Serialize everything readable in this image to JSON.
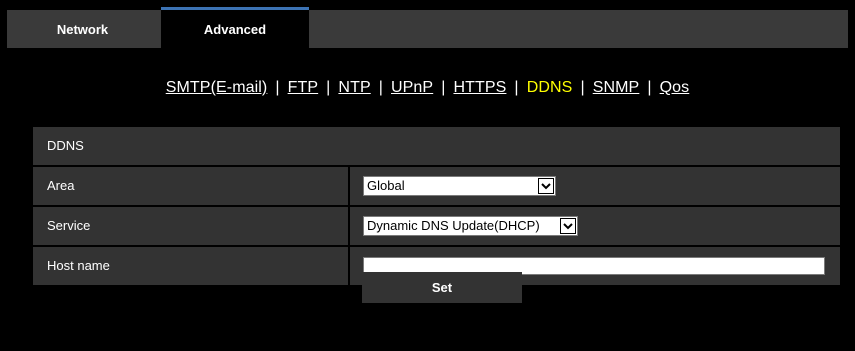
{
  "tabs": {
    "network": "Network",
    "advanced": "Advanced"
  },
  "links": {
    "smtp": "SMTP(E-mail)",
    "ftp": "FTP",
    "ntp": "NTP",
    "upnp": "UPnP",
    "https": "HTTPS",
    "ddns": "DDNS",
    "snmp": "SNMP",
    "qos": "Qos",
    "separator": "|"
  },
  "section": {
    "title": "DDNS"
  },
  "fields": {
    "area_label": "Area",
    "area_value": "Global",
    "service_label": "Service",
    "service_value": "Dynamic DNS Update(DHCP)",
    "hostname_label": "Host name",
    "hostname_value": ""
  },
  "buttons": {
    "set": "Set"
  },
  "colors": {
    "background": "#000000",
    "panel": "#333333",
    "active_link": "#ffff00",
    "tab_accent": "#3c73b4"
  }
}
